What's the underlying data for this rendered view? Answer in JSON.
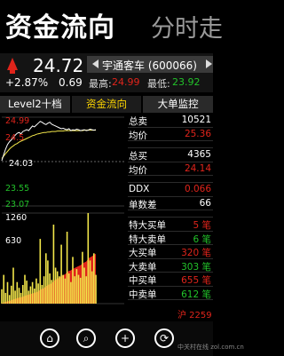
{
  "header": {
    "title": "资金流向",
    "next_title": "分时走"
  },
  "quote": {
    "price": "24.72",
    "change_pct": "+2.87%",
    "change": "0.69",
    "stock": "宇通客车 (600066)",
    "high_label": "最高:",
    "high": "24.99",
    "low_label": "最低:",
    "low": "23.92",
    "colors": {
      "up": "#e0241b",
      "down": "#22c22a"
    }
  },
  "tabs": [
    {
      "label": "Level2十档"
    },
    {
      "label": "资金流向"
    },
    {
      "label": "大单监控"
    }
  ],
  "chart": {
    "y_labels": [
      "24.99",
      "24.5",
      "24.03",
      "23.55",
      "23.07"
    ],
    "volume_labels": [
      "1260",
      "630"
    ],
    "price_line_color": "#ffffff",
    "avg_line_color": "#f2e64a"
  },
  "chart_data": {
    "type": "line",
    "x": [
      0,
      1,
      2,
      3,
      4,
      5,
      6,
      7,
      8,
      9,
      10,
      11,
      12,
      13,
      14,
      15,
      16,
      17,
      18,
      19,
      20,
      21,
      22,
      23,
      24,
      25,
      26,
      27,
      28,
      29,
      30,
      31,
      32,
      33,
      34,
      35,
      36,
      37,
      38,
      39,
      40,
      41,
      42,
      43,
      44,
      45,
      46,
      47,
      48,
      49
    ],
    "series": [
      {
        "values": [
          24.05,
          24.18,
          24.3,
          24.4,
          24.46,
          24.5,
          24.55,
          24.6,
          24.64,
          24.66,
          24.63,
          24.68,
          24.7,
          24.72,
          24.7,
          24.75,
          24.8,
          24.78,
          24.82,
          24.86,
          24.9,
          24.88,
          24.85,
          24.83,
          24.86,
          24.88,
          24.84,
          24.82,
          24.8,
          24.78,
          24.76,
          24.74,
          24.75,
          24.73,
          24.72,
          24.74,
          24.7,
          24.72,
          24.71,
          24.73,
          24.72,
          24.7,
          24.71,
          24.72,
          24.7,
          24.71,
          24.73,
          24.72,
          24.71,
          24.72
        ]
      },
      {
        "values": [
          24.1,
          24.15,
          24.2,
          24.25,
          24.3,
          24.34,
          24.37,
          24.4,
          24.42,
          24.45,
          24.47,
          24.49,
          24.51,
          24.53,
          24.55,
          24.57,
          24.59,
          24.6,
          24.62,
          24.63,
          24.64,
          24.65,
          24.66,
          24.66,
          24.67,
          24.67,
          24.68,
          24.68,
          24.68,
          24.69,
          24.69,
          24.69,
          24.69,
          24.7,
          24.7,
          24.7,
          24.7,
          24.7,
          24.7,
          24.7,
          24.7,
          24.7,
          24.7,
          24.71,
          24.71,
          24.71,
          24.71,
          24.71,
          24.71,
          24.71
        ]
      }
    ],
    "volume": [
      200,
      400,
      150,
      300,
      120,
      250,
      500,
      180,
      300,
      220,
      150,
      260,
      400,
      320,
      180,
      240,
      300,
      210,
      350,
      280,
      900,
      260,
      380,
      700,
      600,
      420,
      330,
      1100,
      500,
      450,
      380,
      820,
      400,
      350,
      1000,
      420,
      300,
      650,
      380,
      480,
      400,
      360,
      720,
      500,
      380,
      1260,
      600,
      450,
      700,
      400
    ],
    "ylim": [
      23.07,
      24.99
    ]
  },
  "stats": [
    {
      "label": "总卖",
      "value": "10521",
      "color": "#ffffff"
    },
    {
      "label": "均价",
      "value": "25.36",
      "color": "#e0241b"
    },
    {
      "label": "",
      "value": "",
      "color": "#ffffff"
    },
    {
      "label": "总买",
      "value": "4365",
      "color": "#ffffff"
    },
    {
      "label": "均价",
      "value": "24.14",
      "color": "#e0241b"
    },
    {
      "label": "",
      "value": "",
      "color": "#ffffff"
    },
    {
      "label": "DDX",
      "value": "0.066",
      "color": "#e0241b"
    },
    {
      "label": "单数差",
      "value": "66",
      "color": "#ffffff"
    },
    {
      "label": "",
      "value": "",
      "color": "#ffffff"
    },
    {
      "label": "特大买单",
      "value": "5 笔",
      "color": "#e0241b"
    },
    {
      "label": "特大卖单",
      "value": "6 笔",
      "color": "#22c22a"
    },
    {
      "label": "大买单",
      "value": "320 笔",
      "color": "#e0241b"
    },
    {
      "label": "大卖单",
      "value": "303 笔",
      "color": "#22c22a"
    },
    {
      "label": "中买单",
      "value": "655 笔",
      "color": "#e0241b"
    },
    {
      "label": "中卖单",
      "value": "612 笔",
      "color": "#22c22a"
    }
  ],
  "footer_note": "沪 2259",
  "appbar": {
    "icons": [
      "home-icon",
      "search-icon",
      "add-icon",
      "refresh-icon"
    ],
    "glyphs": [
      "⌂",
      "⌕",
      "+",
      "⟳"
    ]
  },
  "watermark": "中关村在线 zol.com.cn"
}
